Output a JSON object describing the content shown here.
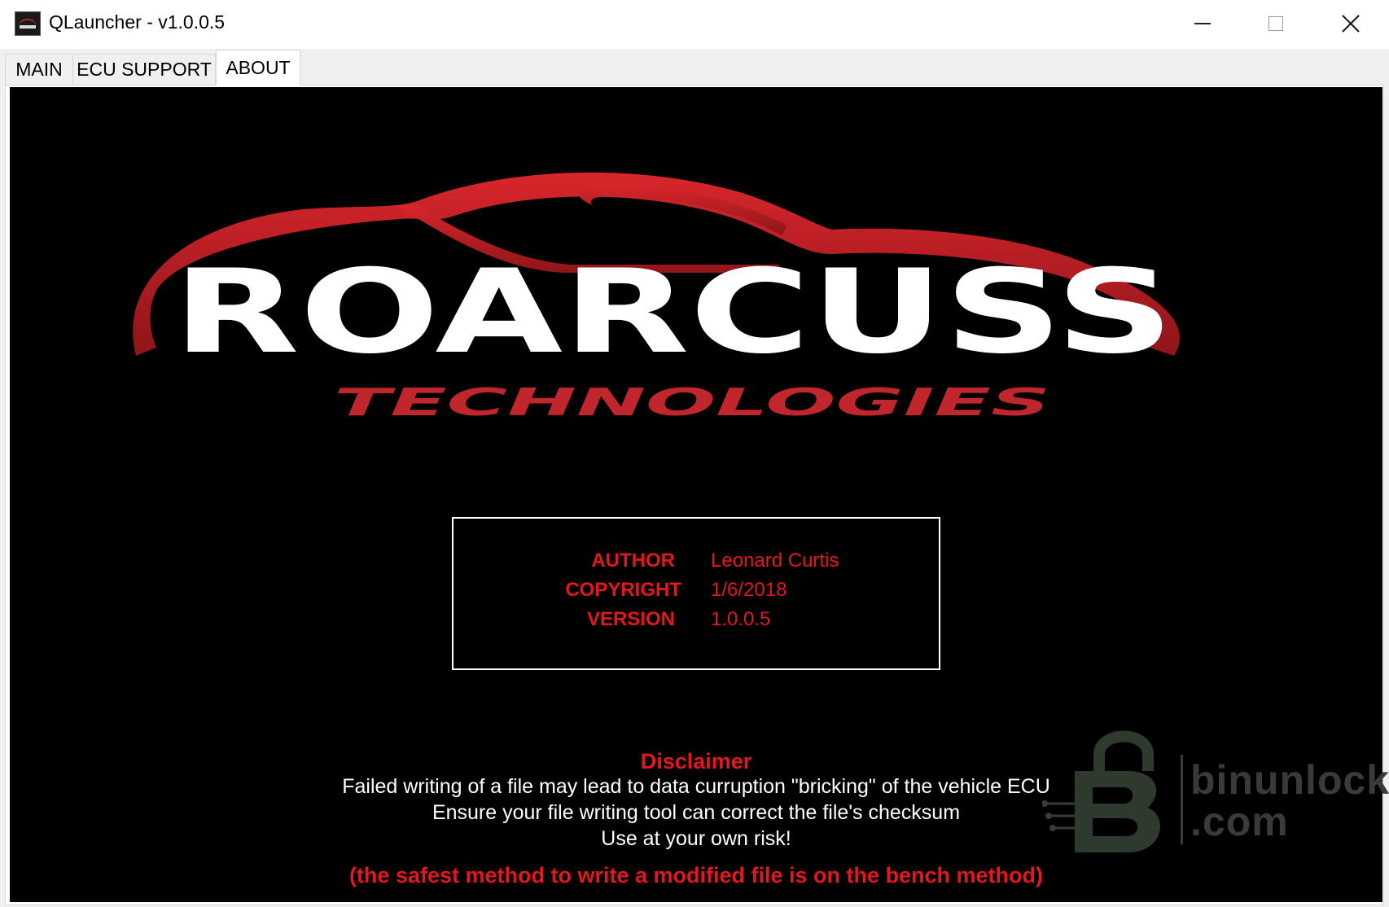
{
  "window": {
    "title": "QLauncher - v1.0.0.5",
    "controls": {
      "minimize": "minimize",
      "maximize": "maximize",
      "close": "close"
    }
  },
  "tabs": [
    {
      "label": "MAIN",
      "active": false
    },
    {
      "label": "ECU SUPPORT",
      "active": false
    },
    {
      "label": "ABOUT",
      "active": true
    }
  ],
  "logo": {
    "brand": "ROARCUSS",
    "subtitle": "TECHNOLOGIES",
    "brand_color": "#ffffff",
    "accent_color": "#c0262b"
  },
  "info": {
    "rows": [
      {
        "label": "AUTHOR",
        "value": "Leonard Curtis"
      },
      {
        "label": "COPYRIGHT",
        "value": "1/6/2018"
      },
      {
        "label": "VERSION",
        "value": "1.0.0.5"
      }
    ]
  },
  "disclaimer": {
    "title": "Disclaimer",
    "lines": [
      "Failed writing of a file may lead to data curruption \"bricking\" of the vehicle ECU",
      "Ensure your file writing tool can correct the file's checksum",
      "Use at your own risk!"
    ],
    "warning": "(the safest method to write a modified file is on the bench method)"
  },
  "watermark": {
    "line1": "binunlock",
    "line2": ".com"
  },
  "colors": {
    "accent": "#e2181e",
    "panel_bg": "#000000",
    "text": "#ffffff"
  }
}
